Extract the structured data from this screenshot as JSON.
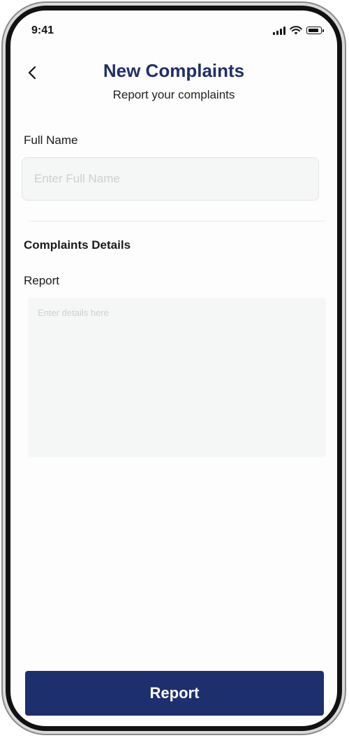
{
  "status_bar": {
    "time": "9:41",
    "icons": [
      "signal-icon",
      "wifi-icon",
      "battery-icon"
    ]
  },
  "header": {
    "back_icon": "chevron-left-icon",
    "title": "New Complaints",
    "subtitle": "Report your complaints"
  },
  "form": {
    "full_name": {
      "label": "Full Name",
      "placeholder": "Enter Full Name",
      "value": ""
    },
    "section_title": "Complaints Details",
    "report": {
      "label": "Report",
      "placeholder": "Enter details here",
      "value": ""
    }
  },
  "actions": {
    "report_label": "Report"
  },
  "colors": {
    "primary": "#1e2f6e",
    "title": "#1f2f6b",
    "input_bg": "#f5f6f6"
  }
}
